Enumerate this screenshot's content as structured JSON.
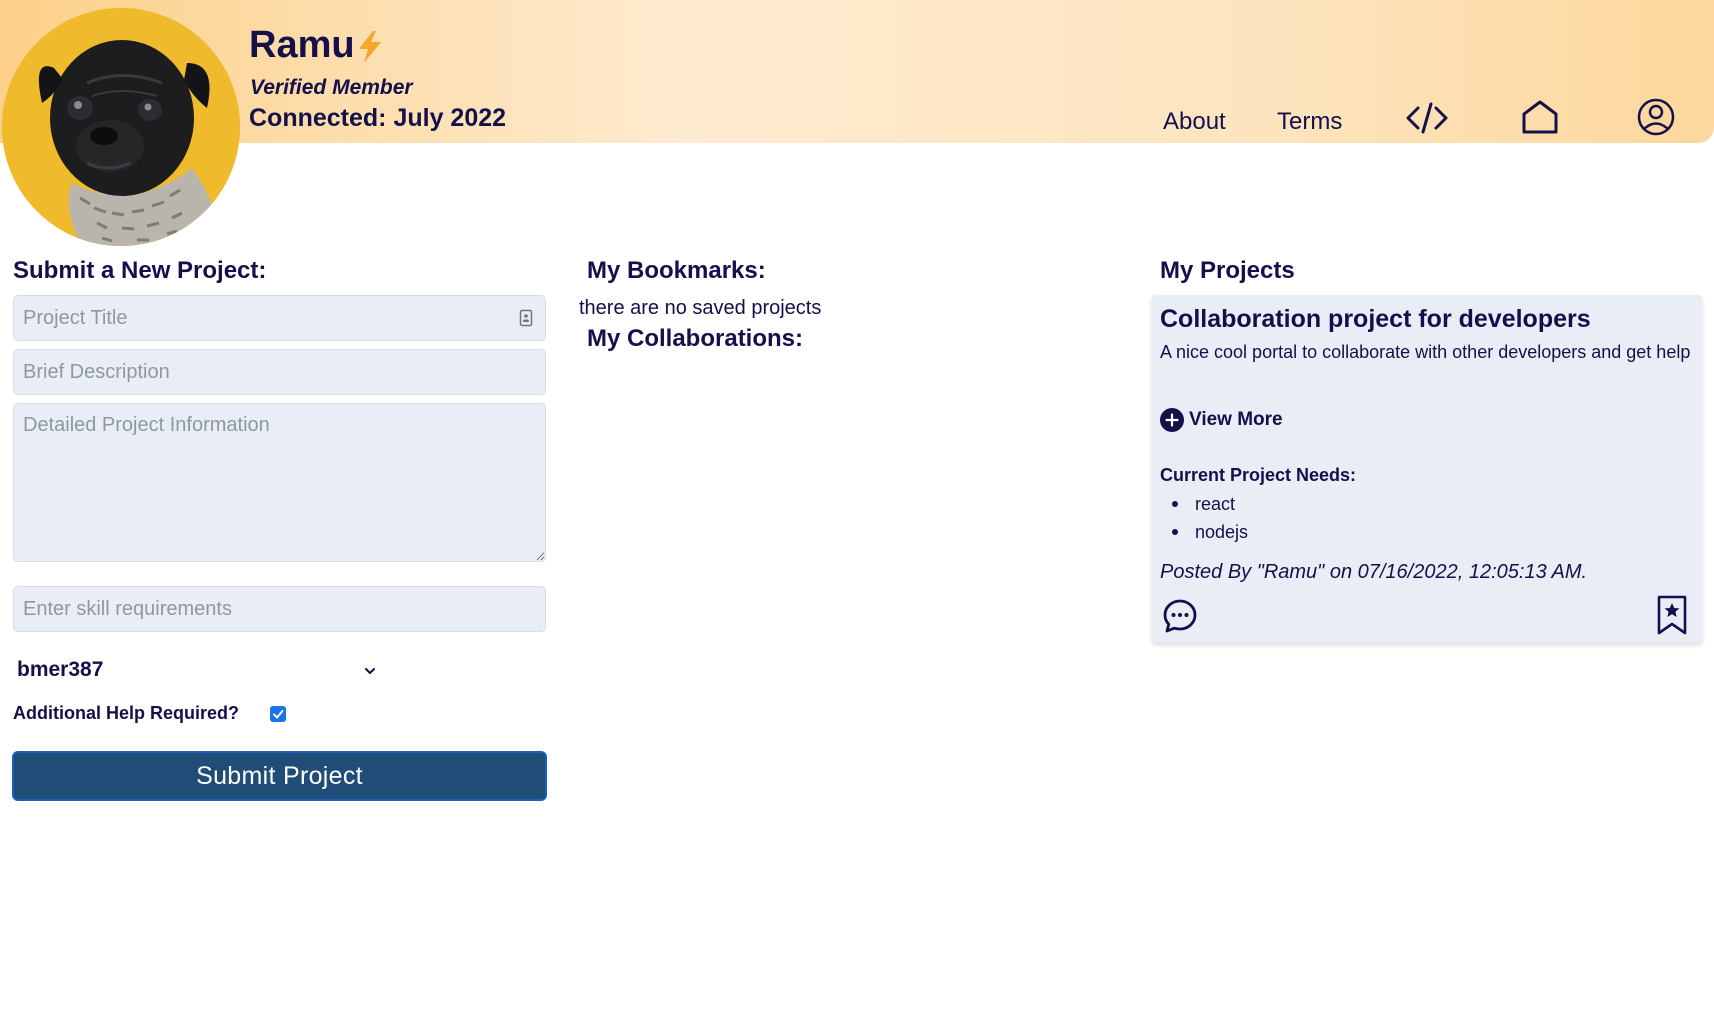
{
  "header": {
    "user_name": "Ramu",
    "status": "Verified Member",
    "connected": "Connected: July 2022",
    "nav": {
      "about": "About",
      "terms": "Terms"
    },
    "icons": [
      "avatar-pug",
      "lightning-bolt-icon",
      "code-icon",
      "home-icon",
      "user-profile-icon"
    ]
  },
  "submit_form": {
    "title": "Submit a New Project:",
    "project_title_placeholder": "Project Title",
    "brief_description_placeholder": "Brief Description",
    "detailed_info_placeholder": "Detailed Project Information",
    "skills_placeholder": "Enter skill requirements",
    "selected_user": "bmer387",
    "help_label": "Additional Help Required?",
    "help_checked": true,
    "submit_label": "Submit Project"
  },
  "bookmarks": {
    "title": "My Bookmarks:",
    "empty_text": "there are no saved projects"
  },
  "collaborations": {
    "title": "My Collaborations:"
  },
  "projects": {
    "title": "My Projects",
    "items": [
      {
        "title": "Collaboration project for developers",
        "description": "A nice cool portal to collaborate with other developers and get help",
        "view_more": "View More",
        "needs_label": "Current Project Needs:",
        "needs": [
          "react",
          "nodejs"
        ],
        "posted": "Posted By \"Ramu\" on 07/16/2022, 12:05:13 AM."
      }
    ]
  },
  "colors": {
    "primary_text": "#14104a",
    "header_gradient_start": "#fcd089",
    "header_gradient_mid": "#feebd0",
    "avatar_bg": "#efbb2c",
    "bolt": "#f4a72a",
    "submit_button": "#1f4d78",
    "field_bg": "#e9eef6",
    "checkbox": "#1a73e8"
  }
}
